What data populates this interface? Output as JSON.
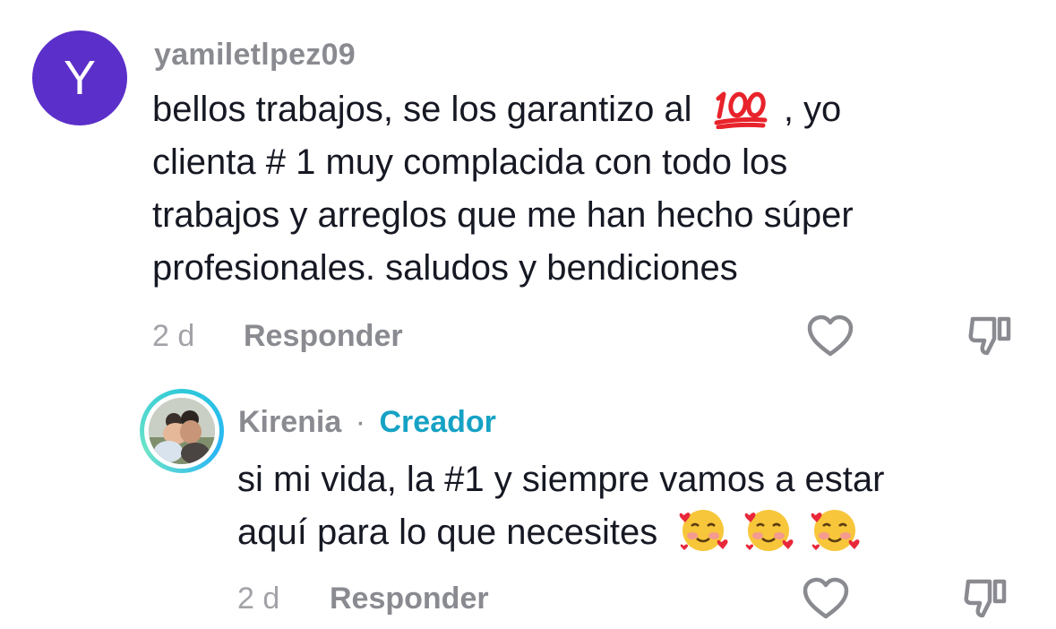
{
  "comments": [
    {
      "avatar_letter": "Y",
      "avatar_color": "#5b2fc9",
      "username": "yamiletlpez09",
      "text_lines": [
        "bellos trabajos, se los garantizo al",
        ", yo",
        "clienta # 1 muy complacida con todo los",
        "trabajos y arreglos que me han hecho súper",
        "profesionales. saludos y bendiciones"
      ],
      "inline_emoji": "hundred-points-emoji",
      "time": "2 d",
      "reply_label": "Responder",
      "like_icon": "heart-outline-icon",
      "dislike_icon": "thumbs-down-outline-icon"
    }
  ],
  "reply": {
    "username": "Kirenia",
    "separator": "·",
    "badge": "Creador",
    "badge_color": "#16a2c4",
    "ring_colors": [
      "#2ec9d9",
      "#29b6f6",
      "#6de3c8"
    ],
    "text_lines": [
      "si mi vida, la #1 y siempre vamos a estar",
      "aquí para lo que necesites"
    ],
    "trailing_emojis": [
      "smiling-face-with-hearts-emoji",
      "smiling-face-with-hearts-emoji",
      "smiling-face-with-hearts-emoji"
    ],
    "time": "2 d",
    "reply_label": "Responder",
    "like_icon": "heart-outline-icon",
    "dislike_icon": "thumbs-down-outline-icon"
  }
}
